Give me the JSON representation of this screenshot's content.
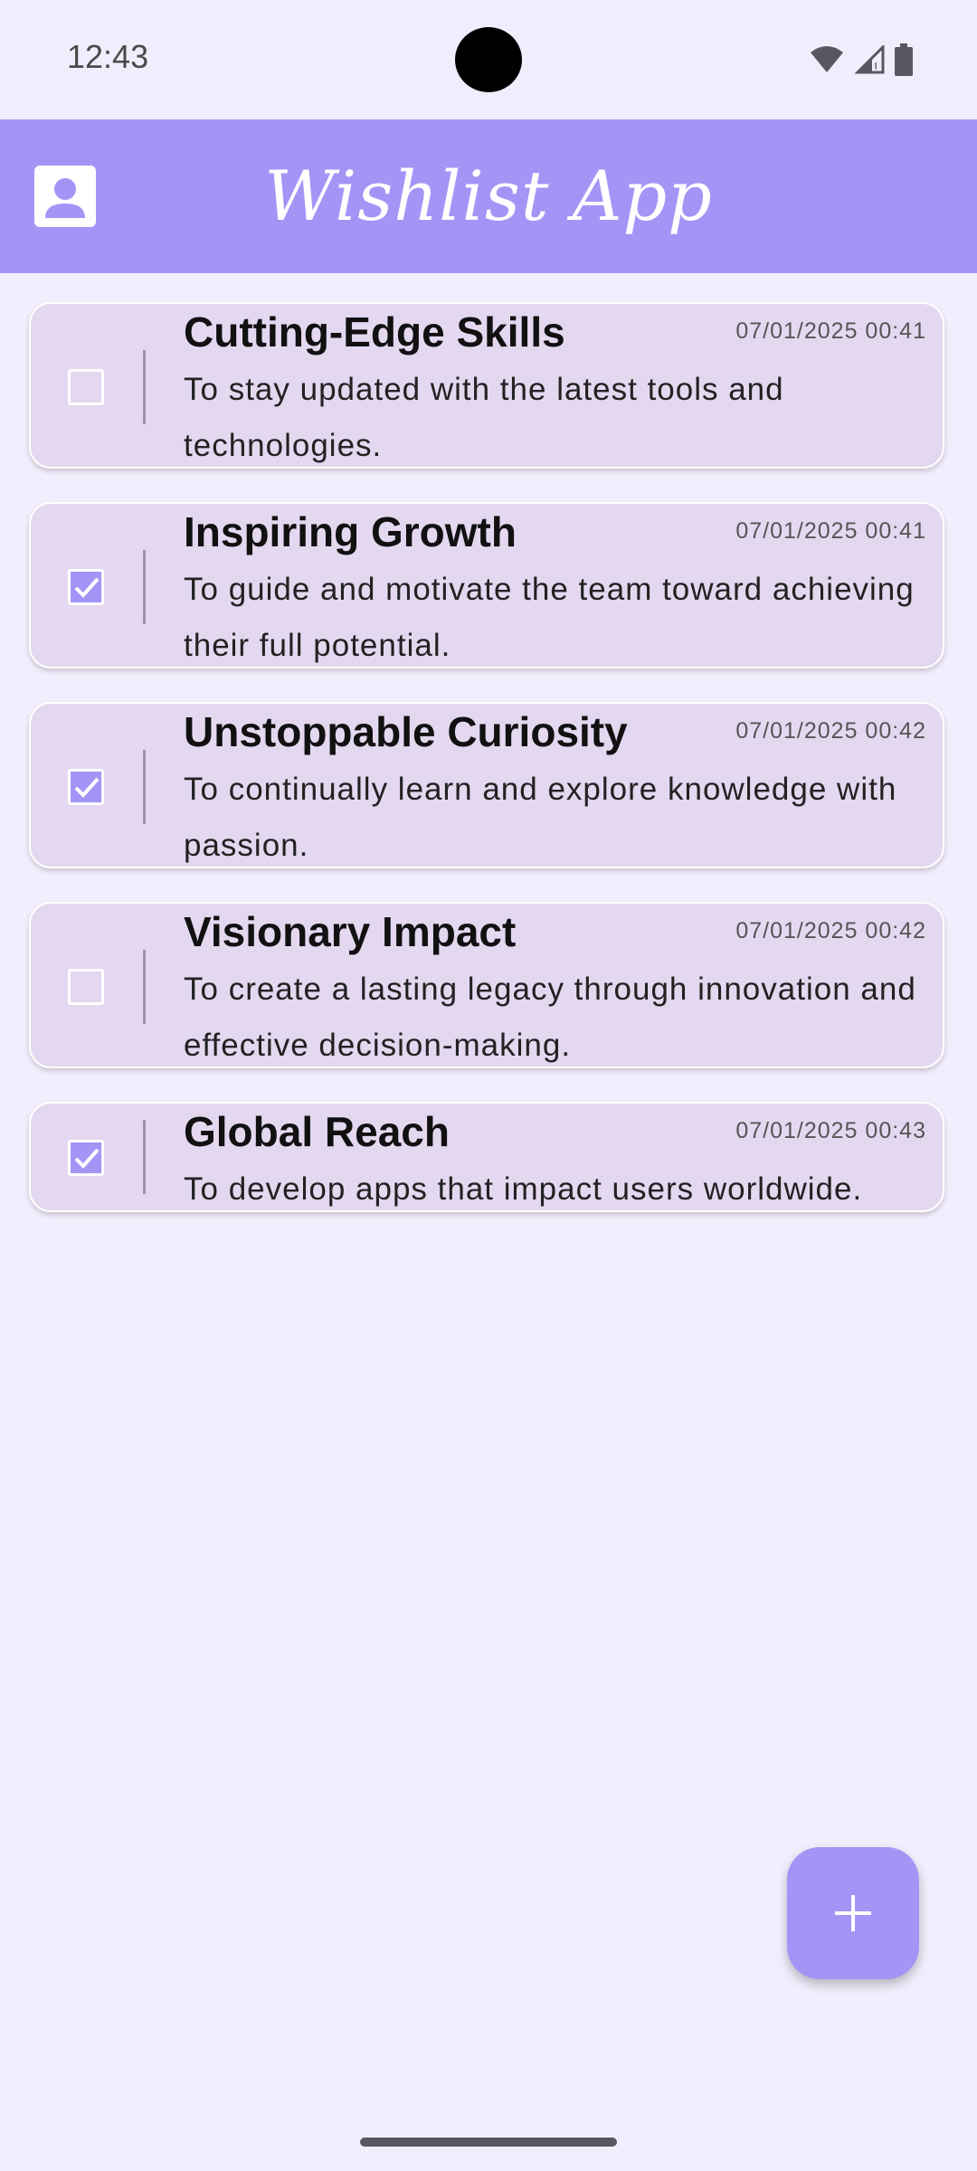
{
  "status_bar": {
    "time": "12:43",
    "icons": [
      "wifi-icon",
      "signal-icon",
      "battery-icon"
    ]
  },
  "app_bar": {
    "title": "Wishlist App",
    "profile_icon": "profile-icon",
    "background": "#A395F6"
  },
  "wishes": [
    {
      "title": "Cutting-Edge Skills",
      "timestamp": "07/01/2025 00:41",
      "description": "To stay updated with the latest tools and technologies.",
      "checked": false
    },
    {
      "title": "Inspiring Growth",
      "timestamp": "07/01/2025 00:41",
      "description": "To guide and motivate the team toward achieving their full potential.",
      "checked": true
    },
    {
      "title": "Unstoppable Curiosity",
      "timestamp": "07/01/2025 00:42",
      "description": "To continually learn and explore knowledge with passion.",
      "checked": true
    },
    {
      "title": "Visionary Impact",
      "timestamp": "07/01/2025 00:42",
      "description": "To create a lasting legacy through innovation and effective decision-making.",
      "checked": false
    },
    {
      "title": "Global Reach",
      "timestamp": "07/01/2025 00:43",
      "description": "To develop apps that impact users worldwide.",
      "checked": true
    }
  ],
  "fab": {
    "icon": "plus-icon"
  },
  "colors": {
    "accent": "#A395F6",
    "background": "#F3EEFD",
    "card": "#E4D8F0"
  }
}
